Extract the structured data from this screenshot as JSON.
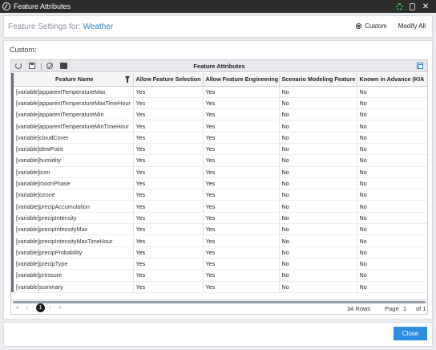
{
  "window": {
    "title": "Feature Attributes"
  },
  "header": {
    "label": "Feature Settings for:",
    "name": "Weather"
  },
  "mode": {
    "options": [
      "Custom",
      "Modify All"
    ],
    "selected": "Custom"
  },
  "section_label": "Custom:",
  "grid": {
    "title": "Feature Attributes",
    "columns": [
      "Feature Name",
      "Allow Feature Selection",
      "Allow Feature Engineering",
      "Scenario Modeling Feature",
      "Known in Advance (KIA"
    ],
    "rows": [
      [
        "[variable]apparentTemperatureMax",
        "Yes",
        "Yes",
        "No",
        "No"
      ],
      [
        "[variable]apparentTemperatureMaxTimeHour",
        "Yes",
        "Yes",
        "No",
        "No"
      ],
      [
        "[variable]apparentTemperatureMin",
        "Yes",
        "Yes",
        "No",
        "No"
      ],
      [
        "[variable]apparentTemperatureMinTimeHour",
        "Yes",
        "Yes",
        "No",
        "No"
      ],
      [
        "[variable]cloudCover",
        "Yes",
        "Yes",
        "No",
        "No"
      ],
      [
        "[variable]dewPoint",
        "Yes",
        "Yes",
        "No",
        "No"
      ],
      [
        "[variable]humidity",
        "Yes",
        "Yes",
        "No",
        "No"
      ],
      [
        "[variable]icon",
        "Yes",
        "Yes",
        "No",
        "No"
      ],
      [
        "[variable]moonPhase",
        "Yes",
        "Yes",
        "No",
        "No"
      ],
      [
        "[variable]ozone",
        "Yes",
        "Yes",
        "No",
        "No"
      ],
      [
        "[variable]precipAccumulation",
        "Yes",
        "Yes",
        "No",
        "No"
      ],
      [
        "[variable]precipIntensity",
        "Yes",
        "Yes",
        "No",
        "No"
      ],
      [
        "[variable]precipIntensityMax",
        "Yes",
        "Yes",
        "No",
        "No"
      ],
      [
        "[variable]precipIntensityMaxTimeHour",
        "Yes",
        "Yes",
        "No",
        "No"
      ],
      [
        "[variable]precipProbability",
        "Yes",
        "Yes",
        "No",
        "No"
      ],
      [
        "[variable]precipType",
        "Yes",
        "Yes",
        "No",
        "No"
      ],
      [
        "[variable]pressure",
        "Yes",
        "Yes",
        "No",
        "No"
      ],
      [
        "[variable]summary",
        "Yes",
        "Yes",
        "No",
        "No"
      ]
    ]
  },
  "pager": {
    "current_page": "1",
    "rows_text": "34 Rows",
    "page_label": "Page",
    "page_value": "1",
    "of_text": "of 1",
    "first": "«",
    "prev": "‹",
    "next": "›",
    "last": "»"
  },
  "footer": {
    "close_label": "Close"
  },
  "colors": {
    "accent": "#2d8fe0",
    "titlebar": "#2b2b2b",
    "link": "#2b7fc4"
  },
  "icons": [
    "app-logo-icon",
    "status-dots-icon",
    "clipboard-icon",
    "close-icon",
    "refresh-icon",
    "save-icon",
    "clear-filter-icon",
    "export-icon",
    "expand-icon",
    "filter-icon"
  ]
}
